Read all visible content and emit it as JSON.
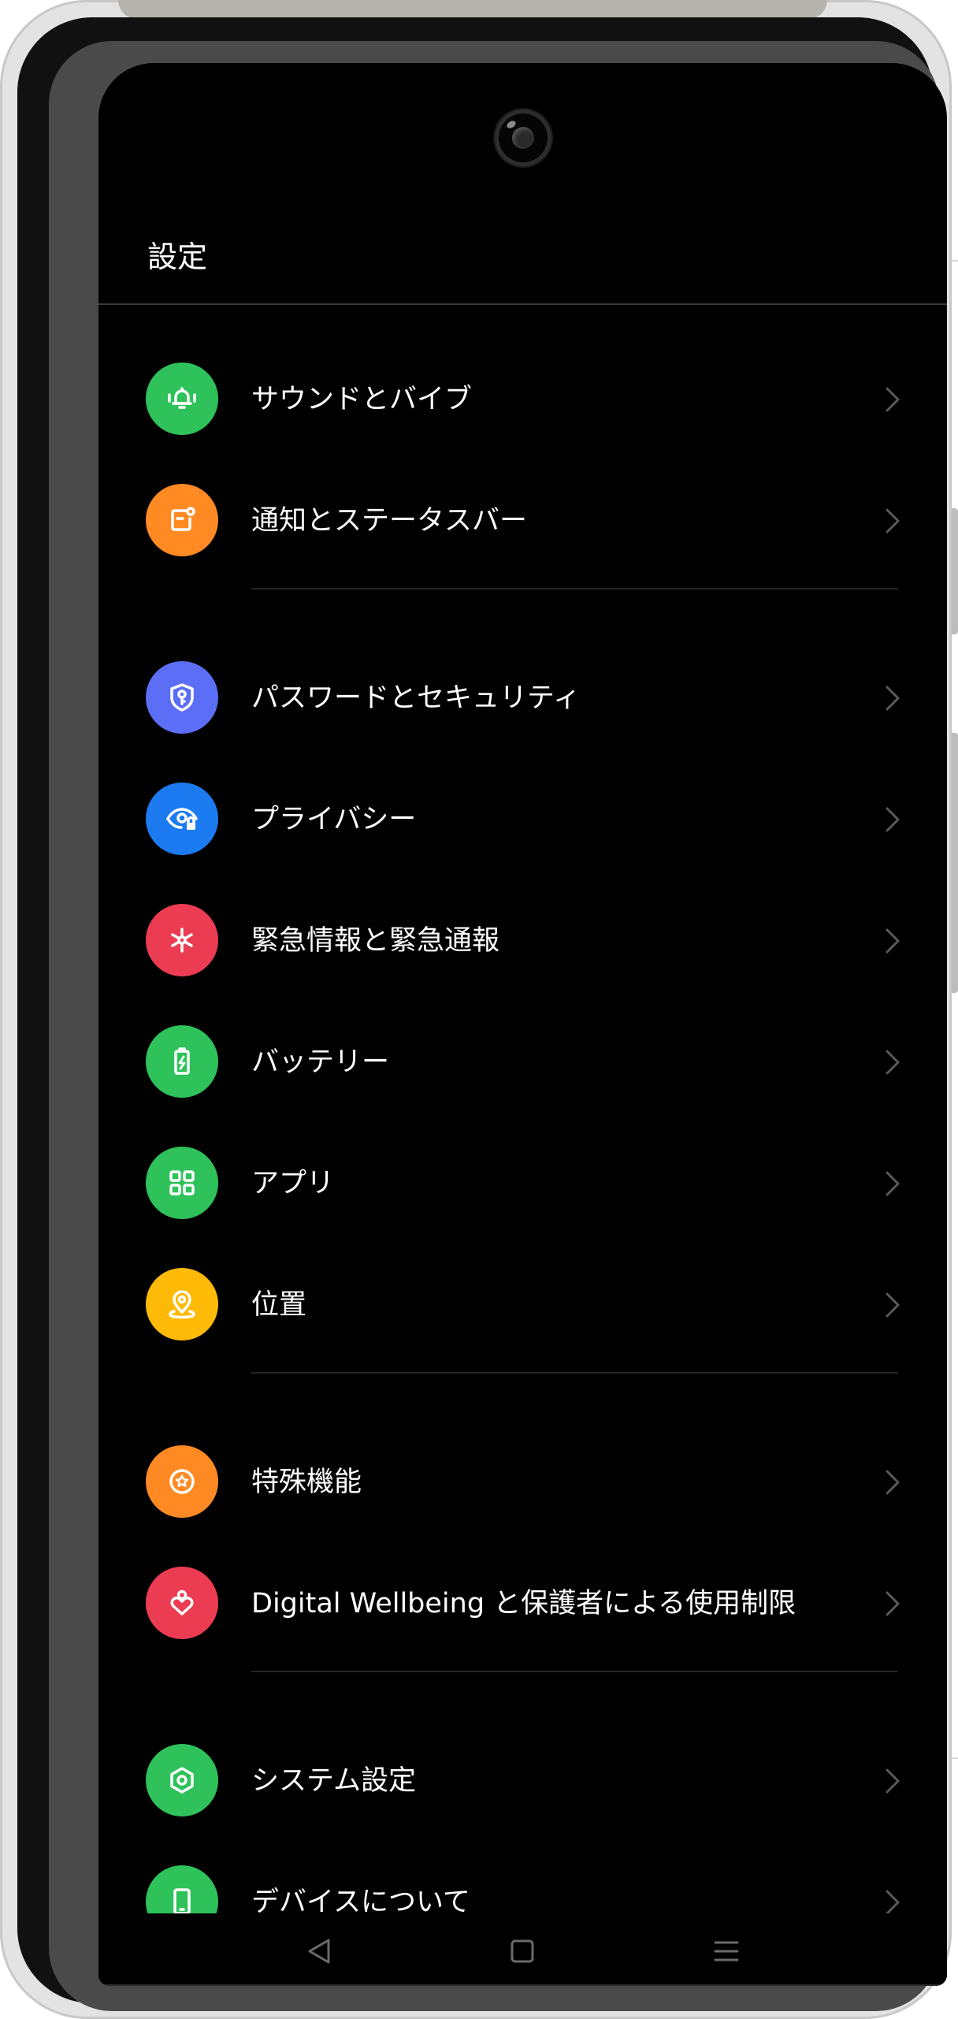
{
  "header": {
    "title": "設定"
  },
  "settings": {
    "sound": {
      "label": "サウンドとバイブ",
      "icon": "bell-vibrate-icon",
      "color": "#2fc25b"
    },
    "notifications": {
      "label": "通知とステータスバー",
      "icon": "notification-icon",
      "color": "#ff8a24"
    },
    "password": {
      "label": "パスワードとセキュリティ",
      "icon": "shield-key-icon",
      "color": "#5b6ef5"
    },
    "privacy": {
      "label": "プライバシー",
      "icon": "eye-lock-icon",
      "color": "#1d7bf2"
    },
    "emergency": {
      "label": "緊急情報と緊急通報",
      "icon": "asterisk-icon",
      "color": "#ec3c52"
    },
    "battery": {
      "label": "バッテリー",
      "icon": "battery-icon",
      "color": "#2fc25b"
    },
    "apps": {
      "label": "アプリ",
      "icon": "apps-grid-icon",
      "color": "#2fc25b"
    },
    "location": {
      "label": "位置",
      "icon": "location-pin-icon",
      "color": "#ffba08"
    },
    "accessibility": {
      "label": "特殊機能",
      "icon": "star-circle-icon",
      "color": "#ff8a24"
    },
    "wellbeing": {
      "label": "Digital Wellbeing と保護者による使用制限",
      "icon": "heart-person-icon",
      "color": "#ec3c52"
    },
    "system": {
      "label": "システム設定",
      "icon": "hexagon-gear-icon",
      "color": "#2fc25b"
    },
    "about": {
      "label": "デバイスについて",
      "icon": "phone-icon",
      "color": "#2fc25b"
    }
  },
  "nav": {
    "back": "back-triangle-icon",
    "home": "home-square-icon",
    "recents": "menu-lines-icon"
  },
  "colors": {
    "background": "#000000",
    "text": "#ffffff",
    "chevron": "#5a5a5a",
    "divider": "#262626"
  }
}
